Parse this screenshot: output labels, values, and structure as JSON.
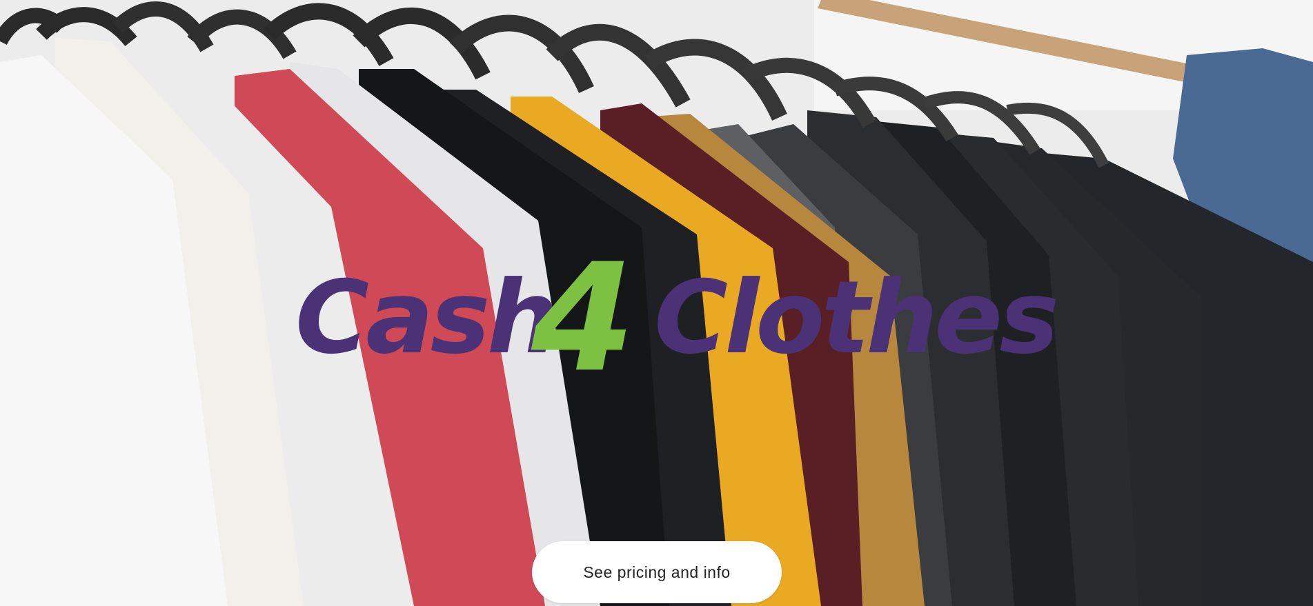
{
  "hero": {
    "image": "photo of shirts on hangers on a clothing rail",
    "logo": {
      "part1": "Cash",
      "part2": "4",
      "part3": "Clothes",
      "color_primary": "#4b3276",
      "color_accent": "#7dc142"
    },
    "cta_label": "See pricing and info"
  }
}
